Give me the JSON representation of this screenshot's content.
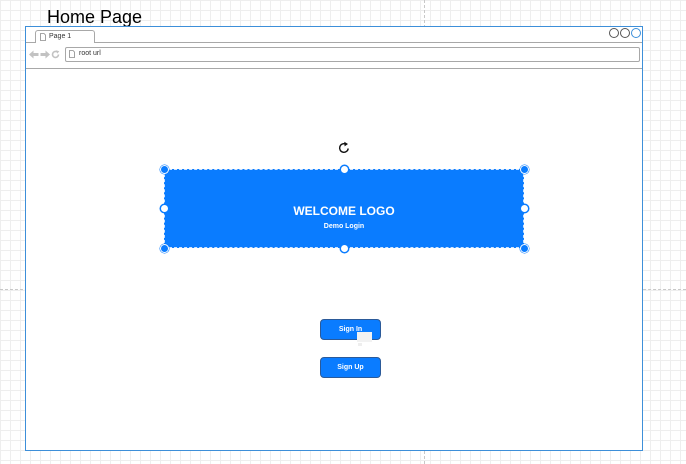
{
  "canvas": {
    "page_label": "Home Page"
  },
  "browser": {
    "tab_label": "Page 1",
    "url": "root url",
    "nav_icons": [
      "back-arrow-icon",
      "forward-arrow-icon",
      "reload-icon"
    ],
    "window_controls": [
      "minimize-circle-icon",
      "restore-circle-icon",
      "maximize-circle-icon"
    ]
  },
  "content": {
    "logo_title": "WELCOME LOGO",
    "logo_subtitle": "Demo Login",
    "signin_label": "Sign In",
    "signup_label": "Sign Up"
  },
  "colors": {
    "accent": "#0a7cff",
    "browser_border": "#3d8fd9",
    "chrome_border": "#a8a8a8",
    "button_border": "#2b5a99"
  }
}
